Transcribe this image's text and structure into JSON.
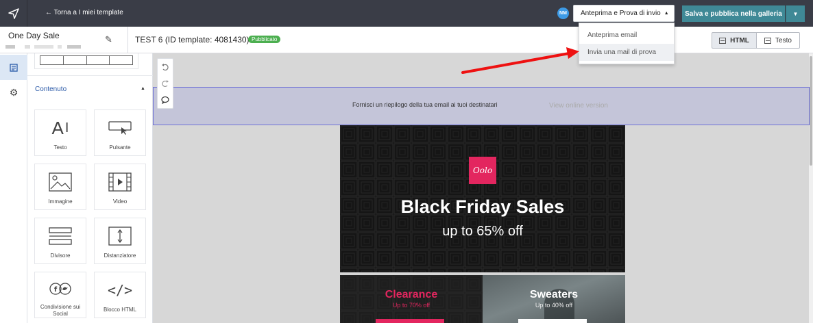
{
  "topbar": {
    "back_label": "← Torna a I miei template",
    "avatar_initials": "NM",
    "preview_label": "Anteprima e Prova di invio",
    "publish_label": "Salva e pubblica nella galleria"
  },
  "dropdown": {
    "items": [
      "Anteprima email",
      "Invia una mail di prova"
    ]
  },
  "template": {
    "name": "One Day Sale",
    "info_prefix": "TEST 6",
    "info_id": "(ID template: 4081430)",
    "status": "Pubblicato"
  },
  "view_toggle": {
    "html_label": "HTML",
    "text_label": "Testo"
  },
  "panel": {
    "section_title": "Contenuto",
    "tiles": [
      {
        "label": "Testo",
        "icon": "text-icon"
      },
      {
        "label": "Pulsante",
        "icon": "button-icon"
      },
      {
        "label": "Immagine",
        "icon": "image-icon"
      },
      {
        "label": "Video",
        "icon": "video-icon"
      },
      {
        "label": "Divisore",
        "icon": "divider-icon"
      },
      {
        "label": "Distanziatore",
        "icon": "spacer-icon"
      },
      {
        "label": "Condivisione sui Social",
        "icon": "social-share-icon"
      },
      {
        "label": "Blocco HTML",
        "icon": "html-block-icon"
      }
    ]
  },
  "canvas": {
    "preheader_text": "Fornisci un riepilogo della tua email ai tuoi destinatari",
    "view_online": "View online version",
    "logo_text": "Oolo",
    "hero_title": "Black Friday Sales",
    "hero_subtitle": "up to 65% off",
    "promo_left_title": "Clearance",
    "promo_left_sub": "Up to 70% off",
    "promo_right_title": "Sweaters",
    "promo_right_sub": "Up to 40% off"
  },
  "colors": {
    "topbar": "#3a3d47",
    "publish": "#3f8996",
    "badge": "#4caf50",
    "accent_pink": "#e3265f",
    "annotation_arrow": "#ee1111"
  }
}
